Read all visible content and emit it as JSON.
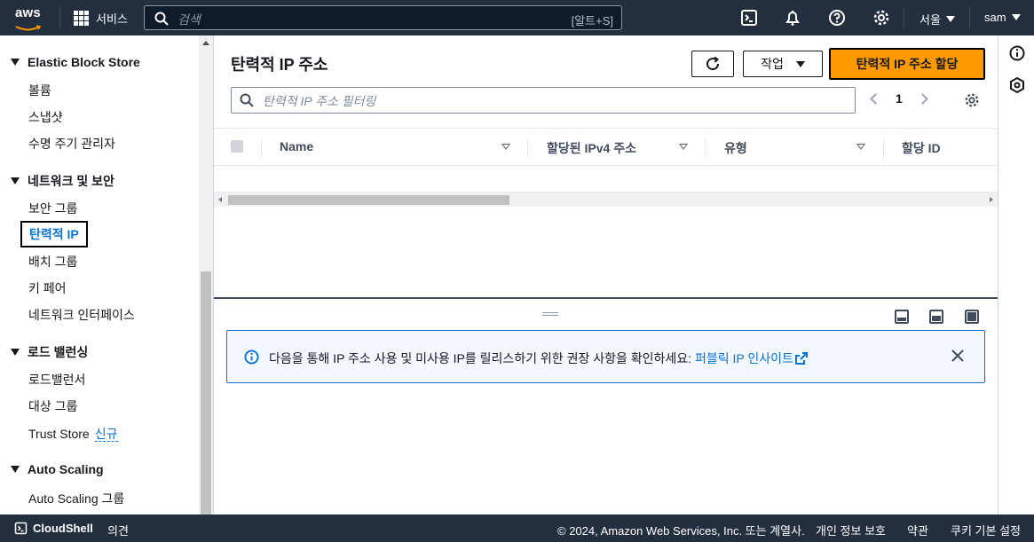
{
  "topnav": {
    "logo_text": "aws",
    "services_label": "서비스",
    "search_placeholder": "검색",
    "search_shortcut": "[알트+S]",
    "region": "서울",
    "user": "sam"
  },
  "sidebar": {
    "sections": [
      {
        "title": "Elastic Block Store",
        "items": [
          "볼륨",
          "스냅샷",
          "수명 주기 관리자"
        ]
      },
      {
        "title": "네트워크 및 보안",
        "items": [
          "보안 그룹",
          "탄력적 IP",
          "배치 그룹",
          "키 페어",
          "네트워크 인터페이스"
        ]
      },
      {
        "title": "로드 밸런싱",
        "items": [
          "로드밸런서",
          "대상 그룹",
          "Trust Store"
        ]
      },
      {
        "title": "Auto Scaling",
        "items": [
          "Auto Scaling 그룹"
        ]
      }
    ],
    "new_badge": "신규",
    "active_item": "탄력적 IP"
  },
  "main": {
    "title": "탄력적 IP 주소",
    "actions_label": "작업",
    "primary_label": "탄력적 IP 주소 할당",
    "filter_placeholder": "탄력적 IP 주소 필터링",
    "page_number": "1",
    "columns": [
      "Name",
      "할당된 IPv4 주소",
      "유형",
      "할당 ID"
    ]
  },
  "alert": {
    "message": "다음을 통해 IP 주소 사용 및 미사용 IP를 릴리스하기 위한 권장 사항을 확인하세요: ",
    "link": "퍼블릭 IP 인사이트"
  },
  "footer": {
    "cloudshell": "CloudShell",
    "feedback": "의견",
    "copyright": "© 2024, Amazon Web Services, Inc. 또는 계열사.",
    "privacy": "개인 정보 보호",
    "terms": "약관",
    "cookies": "쿠키 기본 설정"
  },
  "colors": {
    "nav_bg": "#232f3e",
    "primary": "#ff9900",
    "link": "#0972d3"
  }
}
